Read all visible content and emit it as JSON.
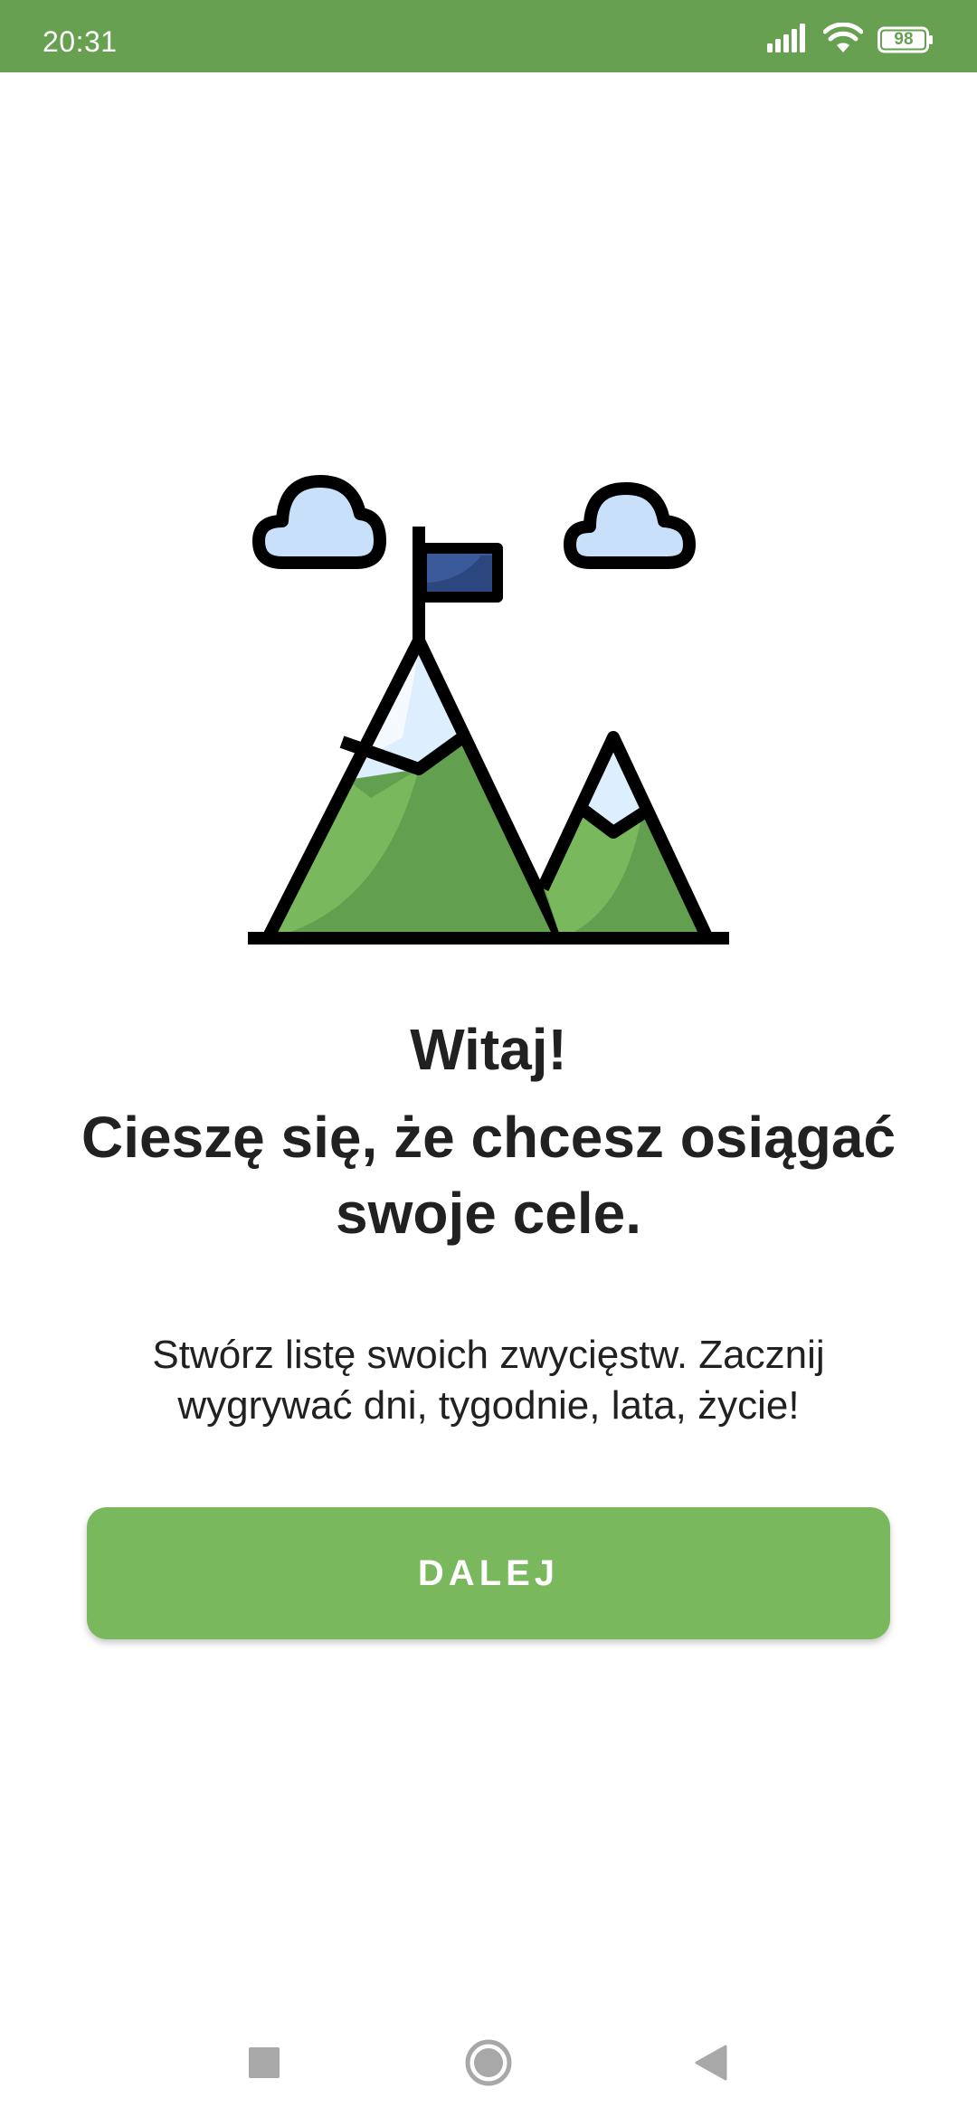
{
  "status_bar": {
    "time": "20:31",
    "battery_level": "98",
    "icons": [
      "signal-icon",
      "wifi-icon",
      "battery-icon"
    ],
    "color": "#66a050"
  },
  "illustration": {
    "icon": "mountains-with-flag-icon",
    "colors": {
      "mountain_light": "#7ab85e",
      "mountain_dark": "#62a050",
      "snow": "#ddeeff",
      "cloud": "#c8e0fa",
      "flag": "#3a5a99",
      "outline": "#000000"
    }
  },
  "content": {
    "title": "Witaj!",
    "subtitle": "Cieszę się, że chcesz osiągać swoje cele.",
    "description": "Stwórz listę swoich zwycięstw. Zacznij wygrywać dni, tygodnie, lata, życie!"
  },
  "actions": {
    "next_label": "DALEJ",
    "button_color": "#7ab85e"
  },
  "nav_bar": {
    "buttons": [
      "recents-button",
      "home-button",
      "back-button"
    ]
  }
}
